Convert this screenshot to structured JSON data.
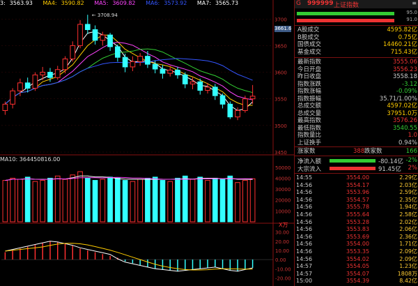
{
  "ma_legend": [
    {
      "label": "3:",
      "value": "3563.93",
      "color": "#ffffff"
    },
    {
      "label": "MA4:",
      "value": "3590.82",
      "color": "#ffcc00"
    },
    {
      "label": "MA5:",
      "value": "3609.82",
      "color": "#ff44ff"
    },
    {
      "label": "MA6:",
      "value": "3573.92",
      "color": "#3355ff"
    },
    {
      "label": "MA7:",
      "value": "3565.73",
      "color": "#ffffff"
    }
  ],
  "peak_label": "3708.94",
  "price_axis": [
    "3700",
    "3650",
    "3600",
    "3550",
    "3500",
    "3450"
  ],
  "price_tag": "3661.6",
  "vol_legend": "MA10: 364450816.00",
  "vol_axis": [
    "50000",
    "40000",
    "30000",
    "20000",
    "10000"
  ],
  "vol_unit": "X万",
  "macd_axis": [
    "30.00",
    "20.00",
    "10.00",
    "0.00",
    "-10.00",
    "-20.00"
  ],
  "colors": {
    "up": "#ff3030",
    "down": "#33ffff",
    "ma_yellow": "#ffcc00",
    "ma_magenta": "#ff44ff",
    "ma_blue": "#3355ff",
    "ma_green": "#33cc33",
    "ma_white": "#ffffff"
  },
  "header": {
    "mark": "G",
    "code": "999999",
    "name": "上证指数",
    "menu_icon": "menu-lines-icon"
  },
  "meters": [
    {
      "value": "95.0"
    },
    {
      "value": "91.0"
    }
  ],
  "stats": [
    {
      "label": "A股成交",
      "value": "4595.82亿",
      "color": "#ffcc00"
    },
    {
      "label": "B股成交",
      "value": "0.75亿",
      "color": "#ffcc00"
    },
    {
      "label": "国债成交",
      "value": "14460.21亿",
      "color": "#ffcc00"
    },
    {
      "label": "基金成交",
      "value": "715.43亿",
      "color": "#ffcc00"
    }
  ],
  "quotes": [
    {
      "label": "最新指数",
      "value": "3555.06",
      "color": "#e33"
    },
    {
      "label": "今日开盘",
      "value": "3556.23",
      "color": "#e33"
    },
    {
      "label": "昨日收盘",
      "value": "3558.18",
      "color": "#ccc"
    },
    {
      "label": "指数涨跌",
      "value": "-3.12",
      "color": "#3c3"
    },
    {
      "label": "指数涨幅",
      "value": "-0.09%",
      "color": "#3c3"
    },
    {
      "label": "指数振幅",
      "value": "35.71/1.00%",
      "color": "#ccc"
    },
    {
      "label": "总成交额",
      "value": "4597.02亿",
      "color": "#ffcc00"
    },
    {
      "label": "总成交量",
      "value": "37951.0万",
      "color": "#ffcc00"
    },
    {
      "label": "最高指数",
      "value": "3576.26",
      "color": "#e33"
    },
    {
      "label": "最低指数",
      "value": "3540.55",
      "color": "#3c3"
    },
    {
      "label": "指数量比",
      "value": "1.0",
      "color": "#e33"
    },
    {
      "label": "上证换手",
      "value": "0.94%",
      "color": "#ccc"
    }
  ],
  "updown": {
    "up_label": "涨家数",
    "up_value": "388",
    "down_label": "跌家数",
    "down_value": "166"
  },
  "flows": [
    {
      "label": "净流入额",
      "num": "-80.14亿",
      "pct": "-2%",
      "color": "#3c3"
    },
    {
      "label": "大宗流入",
      "num": "91.45亿",
      "pct": "2%",
      "color": "#e33"
    }
  ],
  "ticks": [
    {
      "t": "14:55",
      "p": "3554.00",
      "v": "2.29亿"
    },
    {
      "t": "14:56",
      "p": "3554.17",
      "v": "2.03亿"
    },
    {
      "t": "14:56",
      "p": "3553.96",
      "v": "2.59亿"
    },
    {
      "t": "14:56",
      "p": "3554.57",
      "v": "2.35亿"
    },
    {
      "t": "14:56",
      "p": "3555.78",
      "v": "1.94亿"
    },
    {
      "t": "14:56",
      "p": "3555.64",
      "v": "2.58亿"
    },
    {
      "t": "14:56",
      "p": "3553.28",
      "v": "2.02亿"
    },
    {
      "t": "14:56",
      "p": "3553.83",
      "v": "2.06亿"
    },
    {
      "t": "14:56",
      "p": "3553.69",
      "v": "2.36亿"
    },
    {
      "t": "14:56",
      "p": "3554.00",
      "v": "1.71亿"
    },
    {
      "t": "14:56",
      "p": "3553.35",
      "v": "2.09亿"
    },
    {
      "t": "14:56",
      "p": "3554.02",
      "v": "2.09亿"
    },
    {
      "t": "14:57",
      "p": "3554.05",
      "v": "1.23亿"
    },
    {
      "t": "14:57",
      "p": "3554.07",
      "v": "1808万"
    },
    {
      "t": "15:00",
      "p": "3554.39",
      "v": "8.42亿"
    }
  ],
  "chart_data": {
    "type": "candlestick",
    "price_ylim": [
      3450,
      3720
    ],
    "candles": [
      {
        "o": 3528,
        "c": 3540,
        "h": 3545,
        "l": 3520
      },
      {
        "o": 3540,
        "c": 3565,
        "h": 3570,
        "l": 3532
      },
      {
        "o": 3565,
        "c": 3580,
        "h": 3588,
        "l": 3555
      },
      {
        "o": 3580,
        "c": 3570,
        "h": 3590,
        "l": 3562
      },
      {
        "o": 3570,
        "c": 3595,
        "h": 3600,
        "l": 3565
      },
      {
        "o": 3595,
        "c": 3600,
        "h": 3610,
        "l": 3585
      },
      {
        "o": 3600,
        "c": 3590,
        "h": 3608,
        "l": 3582
      },
      {
        "o": 3590,
        "c": 3605,
        "h": 3612,
        "l": 3586
      },
      {
        "o": 3605,
        "c": 3625,
        "h": 3630,
        "l": 3598
      },
      {
        "o": 3625,
        "c": 3650,
        "h": 3658,
        "l": 3620
      },
      {
        "o": 3650,
        "c": 3690,
        "h": 3698,
        "l": 3645
      },
      {
        "o": 3690,
        "c": 3680,
        "h": 3708,
        "l": 3672
      },
      {
        "o": 3680,
        "c": 3660,
        "h": 3688,
        "l": 3652
      },
      {
        "o": 3660,
        "c": 3670,
        "h": 3676,
        "l": 3650
      },
      {
        "o": 3670,
        "c": 3648,
        "h": 3674,
        "l": 3640
      },
      {
        "o": 3648,
        "c": 3628,
        "h": 3652,
        "l": 3620
      },
      {
        "o": 3628,
        "c": 3610,
        "h": 3635,
        "l": 3600
      },
      {
        "o": 3610,
        "c": 3620,
        "h": 3630,
        "l": 3602
      },
      {
        "o": 3620,
        "c": 3630,
        "h": 3636,
        "l": 3612
      },
      {
        "o": 3630,
        "c": 3615,
        "h": 3640,
        "l": 3608
      },
      {
        "o": 3615,
        "c": 3606,
        "h": 3622,
        "l": 3598
      },
      {
        "o": 3606,
        "c": 3598,
        "h": 3614,
        "l": 3588
      },
      {
        "o": 3598,
        "c": 3604,
        "h": 3612,
        "l": 3592
      },
      {
        "o": 3604,
        "c": 3595,
        "h": 3610,
        "l": 3588
      },
      {
        "o": 3595,
        "c": 3578,
        "h": 3600,
        "l": 3570
      },
      {
        "o": 3578,
        "c": 3582,
        "h": 3590,
        "l": 3568
      },
      {
        "o": 3582,
        "c": 3566,
        "h": 3588,
        "l": 3558
      },
      {
        "o": 3566,
        "c": 3572,
        "h": 3580,
        "l": 3560
      },
      {
        "o": 3572,
        "c": 3556,
        "h": 3578,
        "l": 3548
      },
      {
        "o": 3556,
        "c": 3540,
        "h": 3560,
        "l": 3532
      },
      {
        "o": 3540,
        "c": 3516,
        "h": 3545,
        "l": 3512
      },
      {
        "o": 3516,
        "c": 3528,
        "h": 3534,
        "l": 3510
      },
      {
        "o": 3528,
        "c": 3550,
        "h": 3556,
        "l": 3524
      },
      {
        "o": 3550,
        "c": 3555,
        "h": 3576,
        "l": 3540
      }
    ],
    "volume_ylim": [
      0,
      55000
    ],
    "volumes": [
      38000,
      40000,
      39000,
      41000,
      37000,
      38000,
      40000,
      42000,
      39000,
      43000,
      46000,
      40000,
      38000,
      39000,
      41000,
      40000,
      38000,
      37000,
      39000,
      40000,
      41000,
      38000,
      37000,
      40000,
      42000,
      39000,
      41000,
      38000,
      40000,
      39000,
      42000,
      36000,
      38000,
      39500
    ],
    "macd_ylim": [
      -25,
      35
    ],
    "macd_bars": [
      8,
      10,
      12,
      14,
      16,
      18,
      20,
      19,
      17,
      15,
      12,
      10,
      8,
      6,
      4,
      2,
      -2,
      -4,
      -6,
      -8,
      -10,
      -11,
      -12,
      -13,
      -12,
      -11,
      -10,
      -9,
      -8,
      -10,
      -12,
      -13,
      -11,
      -9
    ]
  }
}
